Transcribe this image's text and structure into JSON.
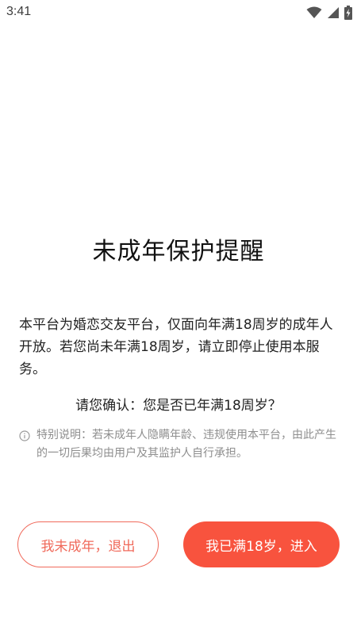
{
  "status_bar": {
    "time": "3:41",
    "icons": [
      "wifi-icon",
      "cellular-signal-icon",
      "battery-charging-icon"
    ]
  },
  "dialog": {
    "title": "未成年保护提醒",
    "notice": "本平台为婚恋交友平台，仅面向年满18周岁的成年人开放。若您尚未年满18周岁，请立即停止使用本服务。",
    "confirm_question": "请您确认：您是否已年满18周岁？",
    "special_note": "特别说明：若未成年人隐瞒年龄、违规使用本平台，由此产生的一切后果均由用户及其监护人自行承担。",
    "info_icon": "info-circle-icon"
  },
  "buttons": {
    "exit_label": "我未成年，退出",
    "enter_label": "我已满18岁，进入"
  },
  "colors": {
    "accent": "#f8533e",
    "outline": "#f06a5b",
    "note_text": "#8e8e8e"
  }
}
